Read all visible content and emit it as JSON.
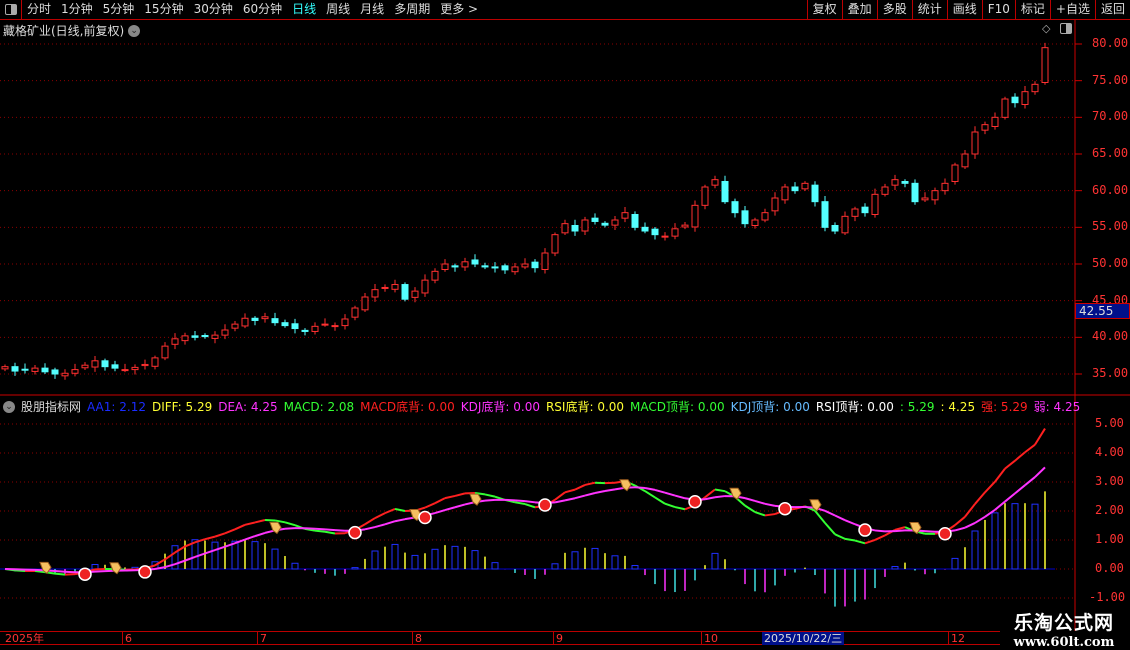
{
  "toolbar": {
    "periods": [
      "分时",
      "1分钟",
      "5分钟",
      "15分钟",
      "30分钟",
      "60分钟",
      "日线",
      "周线",
      "月线",
      "多周期",
      "更多 >"
    ],
    "active_period": "日线",
    "right_buttons": [
      "复权",
      "叠加",
      "多股",
      "统计",
      "画线",
      "F10",
      "标记",
      "+自选",
      "返回"
    ]
  },
  "stock": {
    "title": "藏格矿业(日线,前复权)"
  },
  "price_axis": {
    "ticks": [
      "80.00",
      "75.00",
      "70.00",
      "65.00",
      "60.00",
      "55.00",
      "50.00",
      "45.00",
      "40.00",
      "35.00"
    ],
    "current_price": "42.55"
  },
  "indicator": {
    "name": "股朋指标网",
    "legend": [
      {
        "text": "AA1: 2.12",
        "color": "#1a2cff"
      },
      {
        "text": "DIFF: 5.29",
        "color": "#ffff33"
      },
      {
        "text": "DEA: 4.25",
        "color": "#ff33ff"
      },
      {
        "text": "MACD: 2.08",
        "color": "#33ff33"
      },
      {
        "text": "MACD底背: 0.00",
        "color": "#ff2020"
      },
      {
        "text": "KDJ底背: 0.00",
        "color": "#ff33ff"
      },
      {
        "text": "RSI底背: 0.00",
        "color": "#ffff33"
      },
      {
        "text": "MACD顶背: 0.00",
        "color": "#33ff33"
      },
      {
        "text": "KDJ顶背: 0.00",
        "color": "#66bbff"
      },
      {
        "text": "RSI顶背: 0.00",
        "color": "#ffffff"
      },
      {
        "text": ": 5.29",
        "color": "#33ff33"
      },
      {
        "text": ": 4.25",
        "color": "#ffff33"
      },
      {
        "text": "强: 5.29",
        "color": "#ff2020"
      },
      {
        "text": "弱: 4.25",
        "color": "#ff33ff"
      }
    ],
    "axis_ticks": [
      "5.00",
      "4.00",
      "3.00",
      "2.00",
      "1.00",
      "0.00",
      "-1.00"
    ]
  },
  "time_axis": {
    "labels": [
      "2025年",
      "6",
      "7",
      "8",
      "9",
      "10",
      "12"
    ],
    "cursor": "2025/10/22/三"
  },
  "watermark": {
    "line1": "乐淘公式网",
    "line2": "www.60lt.com"
  },
  "colors": {
    "up": "#ff3030",
    "down": "#54ffff",
    "grid": "#8b0000",
    "dea": "#ff33ff"
  },
  "chart_data": {
    "type": "candlestick",
    "price_range": [
      33,
      82
    ],
    "indicator_range": [
      -1.5,
      5.6
    ],
    "closes": [
      36.0,
      35.4,
      35.6,
      35.8,
      35.3,
      35.0,
      35.1,
      35.6,
      36.2,
      36.8,
      36.0,
      35.8,
      35.6,
      35.9,
      36.3,
      37.2,
      38.8,
      39.8,
      40.2,
      40.0,
      40.1,
      40.3,
      41.0,
      41.8,
      42.6,
      42.3,
      42.8,
      42.0,
      41.6,
      41.2,
      40.8,
      41.5,
      41.8,
      41.6,
      42.5,
      44.0,
      45.5,
      46.5,
      46.8,
      47.2,
      45.2,
      46.3,
      47.8,
      49.0,
      50.0,
      49.6,
      50.3,
      50.0,
      49.6,
      49.5,
      49.2,
      49.6,
      50.0,
      49.5,
      51.5,
      54.0,
      55.5,
      54.5,
      56.0,
      55.8,
      55.3,
      56.0,
      57.0,
      55.0,
      54.5,
      54.0,
      53.8,
      54.8,
      55.3,
      58.0,
      60.5,
      61.5,
      58.5,
      57.0,
      55.5,
      56.0,
      57.0,
      59.0,
      60.5,
      60.0,
      61.0,
      58.5,
      55.0,
      54.5,
      56.5,
      57.5,
      57.0,
      59.5,
      60.5,
      61.5,
      61.0,
      58.5,
      59.0,
      60.0,
      61.0,
      63.5,
      65.0,
      68.0,
      69.0,
      70.0,
      72.5,
      72.0,
      73.5,
      74.5,
      79.5
    ],
    "signals": [
      {
        "i": 4,
        "type": "hand"
      },
      {
        "i": 8,
        "type": "ball"
      },
      {
        "i": 11,
        "type": "hand"
      },
      {
        "i": 14,
        "type": "ball"
      },
      {
        "i": 27,
        "type": "hand"
      },
      {
        "i": 35,
        "type": "ball"
      },
      {
        "i": 41,
        "type": "hand"
      },
      {
        "i": 42,
        "type": "ball"
      },
      {
        "i": 47,
        "type": "hand"
      },
      {
        "i": 54,
        "type": "ball"
      },
      {
        "i": 62,
        "type": "hand"
      },
      {
        "i": 69,
        "type": "ball"
      },
      {
        "i": 73,
        "type": "hand"
      },
      {
        "i": 78,
        "type": "ball"
      },
      {
        "i": 81,
        "type": "hand"
      },
      {
        "i": 86,
        "type": "ball"
      },
      {
        "i": 91,
        "type": "hand"
      },
      {
        "i": 94,
        "type": "ball"
      }
    ]
  }
}
